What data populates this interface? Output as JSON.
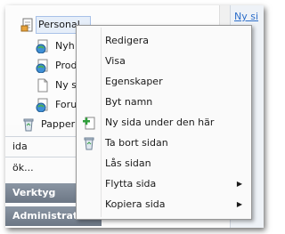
{
  "tree": {
    "items": [
      {
        "label": "Personal",
        "icon": "page-icon"
      },
      {
        "label": "Nyh",
        "icon": "globe-page-icon"
      },
      {
        "label": "Prod",
        "icon": "globe-page-icon"
      },
      {
        "label": "Ny s",
        "icon": "blank-page-icon"
      },
      {
        "label": "Foru",
        "icon": "globe-page-icon"
      }
    ],
    "recycle_label": "Papper"
  },
  "sidebar": {
    "partial_a": "ida",
    "partial_b": "ök...",
    "tools_label": "Verktyg",
    "admin_label": "Administration"
  },
  "right_panel": {
    "link": "Ny si"
  },
  "context_menu": {
    "items": [
      {
        "label": "Redigera"
      },
      {
        "label": "Visa"
      },
      {
        "label": "Egenskaper"
      },
      {
        "label": "Byt namn"
      },
      {
        "label": "Ny sida under den här",
        "icon": "new-page-icon"
      },
      {
        "label": "Ta bort sidan",
        "icon": "recycle-bin-icon"
      },
      {
        "label": "Lås sidan"
      },
      {
        "label": "Flytta sida",
        "submenu": true
      },
      {
        "label": "Kopiera sida",
        "submenu": true
      }
    ]
  }
}
